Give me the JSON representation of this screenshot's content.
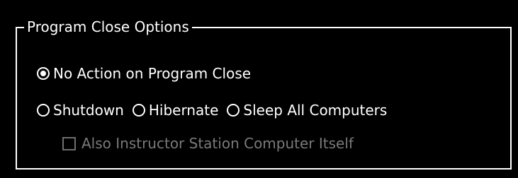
{
  "group": {
    "title": "Program Close Options"
  },
  "options": {
    "no_action": {
      "label": "No Action on Program Close",
      "selected": true
    },
    "shutdown": {
      "label": "Shutdown",
      "selected": false
    },
    "hibernate": {
      "label": "Hibernate",
      "selected": false
    },
    "sleep_all": {
      "label": "Sleep All Computers",
      "selected": false
    }
  },
  "also_instructor": {
    "label": "Also Instructor Station Computer Itself",
    "checked": false,
    "enabled": false
  },
  "colors": {
    "background": "#000000",
    "foreground": "#ffffff",
    "disabled": "#7a7a7a"
  }
}
